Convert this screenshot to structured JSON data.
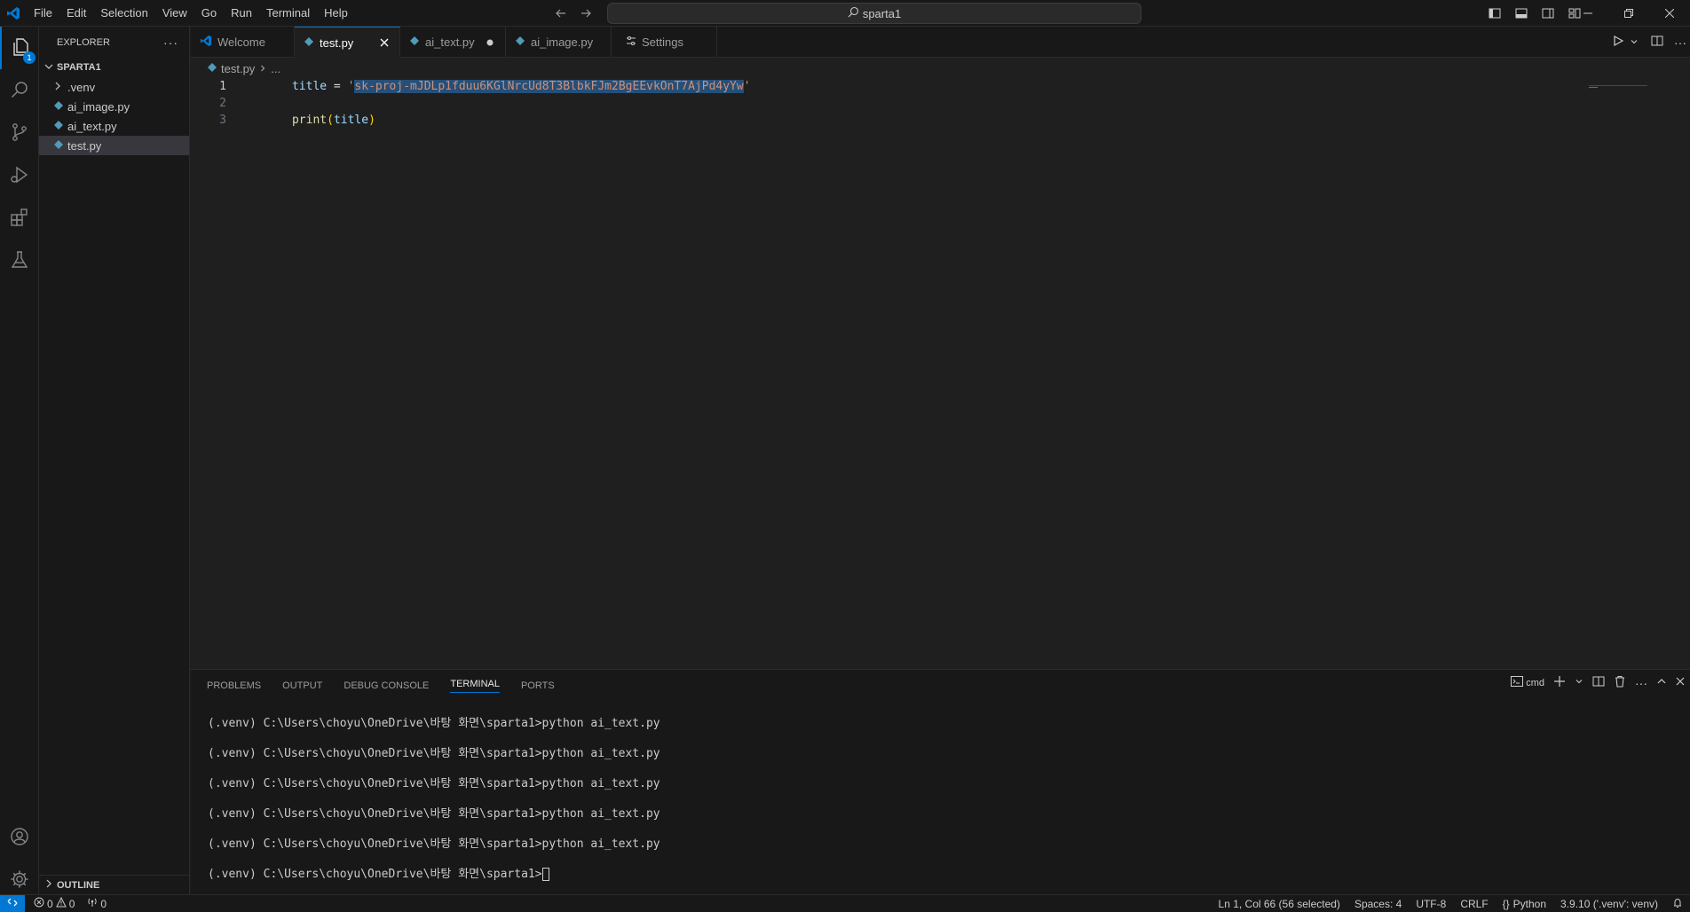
{
  "menu": [
    "File",
    "Edit",
    "Selection",
    "View",
    "Go",
    "Run",
    "Terminal",
    "Help"
  ],
  "search": {
    "text": "sparta1"
  },
  "activity": {
    "explorer_badge": "1"
  },
  "sidebar": {
    "title": "EXPLORER",
    "folder": "SPARTA1",
    "items": [
      {
        "label": ".venv",
        "type": "folder"
      },
      {
        "label": "ai_image.py",
        "type": "python"
      },
      {
        "label": "ai_text.py",
        "type": "python"
      },
      {
        "label": "test.py",
        "type": "python",
        "selected": true
      }
    ],
    "outline": "OUTLINE"
  },
  "tabs": [
    {
      "label": "Welcome",
      "icon": "vscode-icon"
    },
    {
      "label": "test.py",
      "icon": "python-icon",
      "active": true
    },
    {
      "label": "ai_text.py",
      "icon": "python-icon",
      "modified": true
    },
    {
      "label": "ai_image.py",
      "icon": "python-icon"
    },
    {
      "label": "Settings",
      "icon": "settings-icon"
    }
  ],
  "breadcrumb": {
    "file": "test.py",
    "rest": "..."
  },
  "editor": {
    "lines": [
      {
        "num": "1",
        "var": "title",
        "op": " = ",
        "quote_open": "'",
        "str": "sk-proj-mJDLp1fduu6KGlNrcUd8T3BlbkFJm2BgEEvkOnT7AjPd4yYw",
        "quote_close": "'"
      },
      {
        "num": "2"
      },
      {
        "num": "3",
        "fn": "print",
        "paren_open": "(",
        "arg": "title",
        "paren_close": ")"
      }
    ]
  },
  "panel": {
    "tabs": [
      "PROBLEMS",
      "OUTPUT",
      "DEBUG CONSOLE",
      "TERMINAL",
      "PORTS"
    ],
    "active_tab": "TERMINAL",
    "shell": "cmd",
    "terminal_lines": [
      "(.venv) C:\\Users\\choyu\\OneDrive\\바탕 화면\\sparta1>python ai_text.py",
      "(.venv) C:\\Users\\choyu\\OneDrive\\바탕 화면\\sparta1>python ai_text.py",
      "(.venv) C:\\Users\\choyu\\OneDrive\\바탕 화면\\sparta1>python ai_text.py",
      "(.venv) C:\\Users\\choyu\\OneDrive\\바탕 화면\\sparta1>python ai_text.py",
      "(.venv) C:\\Users\\choyu\\OneDrive\\바탕 화면\\sparta1>python ai_text.py",
      "(.venv) C:\\Users\\choyu\\OneDrive\\바탕 화면\\sparta1>"
    ]
  },
  "status": {
    "errors": "0",
    "warnings": "0",
    "ports": "0",
    "position": "Ln 1, Col 66 (56 selected)",
    "spaces": "Spaces: 4",
    "encoding": "UTF-8",
    "eol": "CRLF",
    "language": "Python",
    "interpreter": "3.9.10 ('.venv': venv)"
  },
  "colors": {
    "accent": "#0078d4",
    "background": "#1f1f1f",
    "chrome": "#181818"
  }
}
